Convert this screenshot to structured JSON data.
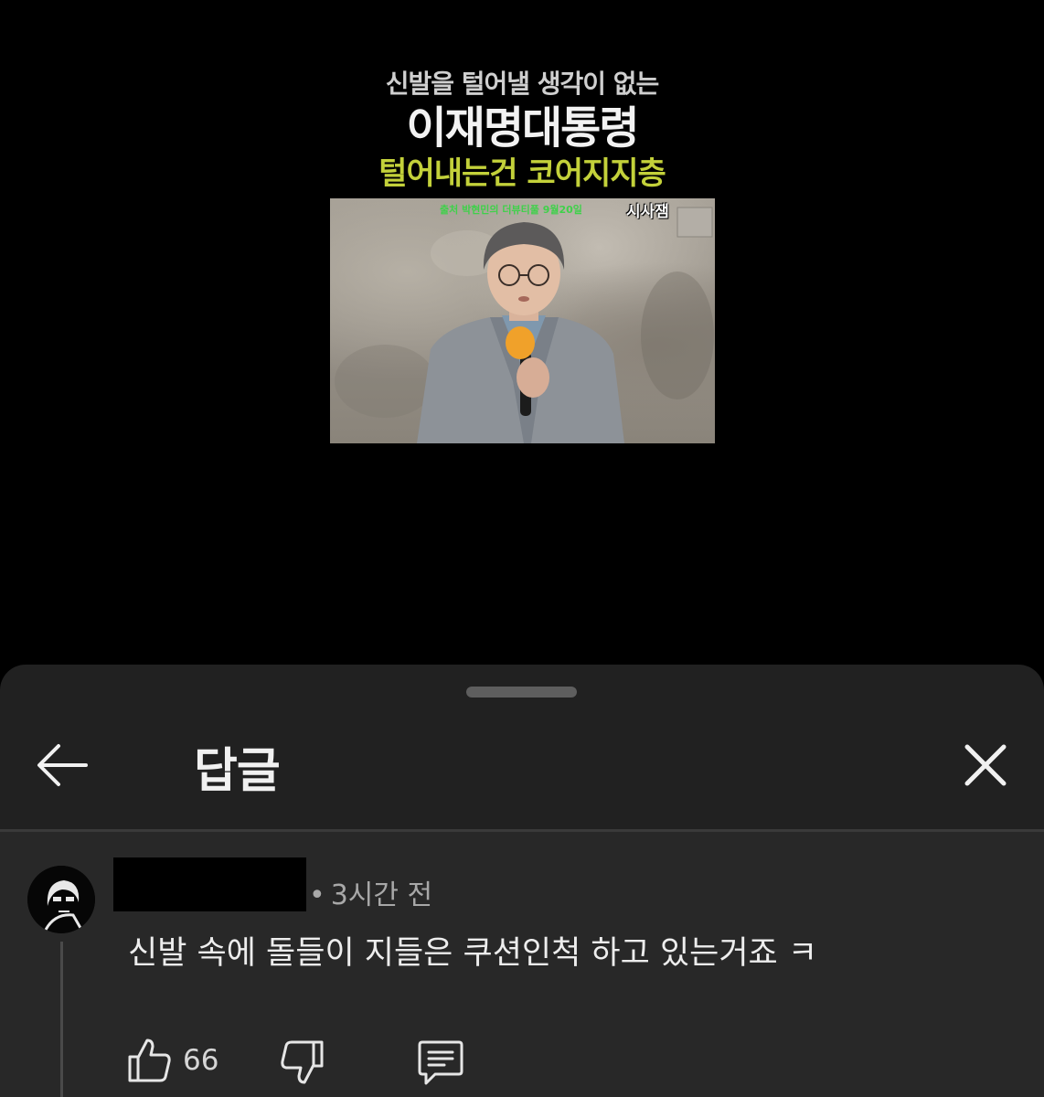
{
  "video": {
    "caption_line1": "신발을 털어낼 생각이 없는",
    "caption_line2": "이재명대통령",
    "caption_line3": "털어내는건 코어지지층",
    "thumbnail_source": "출처 박현민의 더뷰티풀 9월20일",
    "thumbnail_channel": "시사잼"
  },
  "sheet": {
    "title": "답글",
    "back_icon": "arrow-left-icon",
    "close_icon": "close-icon"
  },
  "comment": {
    "time": "3시간 전",
    "separator": "•",
    "text": "신발 속에 돌들이 지들은 쿠션인척 하고 있는거죠 ㅋ",
    "likes": "66",
    "icons": [
      "thumbs-up-icon",
      "thumbs-down-icon",
      "reply-icon"
    ]
  },
  "colors": {
    "sheet_bg": "#212121",
    "comment_bg": "#282828",
    "caption_accent": "#c3d13a"
  }
}
